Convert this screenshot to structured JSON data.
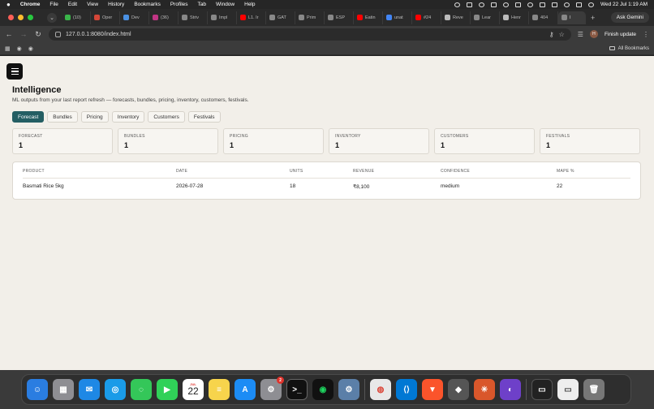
{
  "menubar": {
    "app": "Chrome",
    "items": [
      "File",
      "Edit",
      "View",
      "History",
      "Bookmarks",
      "Profiles",
      "Tab",
      "Window",
      "Help"
    ],
    "datetime": "Wed 22 Jul  1:19 AM"
  },
  "browser": {
    "tabs": [
      {
        "label": "(10)",
        "color": "#3ab54a"
      },
      {
        "label": "Oper",
        "color": "#d44638"
      },
      {
        "label": "Dev",
        "color": "#4a90e2"
      },
      {
        "label": "(36)",
        "color": "#c13584"
      },
      {
        "label": "Striv",
        "color": "#888888"
      },
      {
        "label": "Impl",
        "color": "#888888"
      },
      {
        "label": "L1. Ir",
        "color": "#ff0000"
      },
      {
        "label": "GAT",
        "color": "#888888"
      },
      {
        "label": "Prim",
        "color": "#888888"
      },
      {
        "label": "ESP",
        "color": "#888888"
      },
      {
        "label": "Eatin",
        "color": "#ff0000"
      },
      {
        "label": "unat",
        "color": "#4285f4"
      },
      {
        "label": "#24",
        "color": "#ff0000"
      },
      {
        "label": "Reve",
        "color": "#bbbbbb"
      },
      {
        "label": "Lear",
        "color": "#888888"
      },
      {
        "label": "Henr",
        "color": "#bbbbbb"
      },
      {
        "label": "404",
        "color": "#888888"
      },
      {
        "label": "I",
        "color": "#888888"
      }
    ],
    "new_tab": "+",
    "gemini_label": "Ask Gemini",
    "url": "127.0.0.1:8080/index.html",
    "avatar_initial": "H",
    "finish_update": "Finish update",
    "all_bookmarks": "All Bookmarks"
  },
  "page": {
    "title": "Intelligence",
    "subtitle": "ML outputs from your last report refresh — forecasts, bundles, pricing, inventory, customers, festivals.",
    "tabs": [
      {
        "label": "Forecast",
        "active": true
      },
      {
        "label": "Bundles",
        "active": false
      },
      {
        "label": "Pricing",
        "active": false
      },
      {
        "label": "Inventory",
        "active": false
      },
      {
        "label": "Customers",
        "active": false
      },
      {
        "label": "Festivals",
        "active": false
      }
    ],
    "cards": [
      {
        "label": "FORECAST",
        "value": "1"
      },
      {
        "label": "BUNDLES",
        "value": "1"
      },
      {
        "label": "PRICING",
        "value": "1"
      },
      {
        "label": "INVENTORY",
        "value": "1"
      },
      {
        "label": "CUSTOMERS",
        "value": "1"
      },
      {
        "label": "FESTIVALS",
        "value": "1"
      }
    ],
    "table": {
      "columns": [
        "PRODUCT",
        "DATE",
        "UNITS",
        "REVENUE",
        "CONFIDENCE",
        "MAPE %"
      ],
      "rows": [
        [
          "Basmati Rice 5kg",
          "2026-07-28",
          "18",
          "₹8,100",
          "medium",
          "22"
        ]
      ]
    }
  },
  "dock": {
    "calendar_month": "JUL",
    "calendar_day": "22",
    "settings_badge": "2"
  }
}
